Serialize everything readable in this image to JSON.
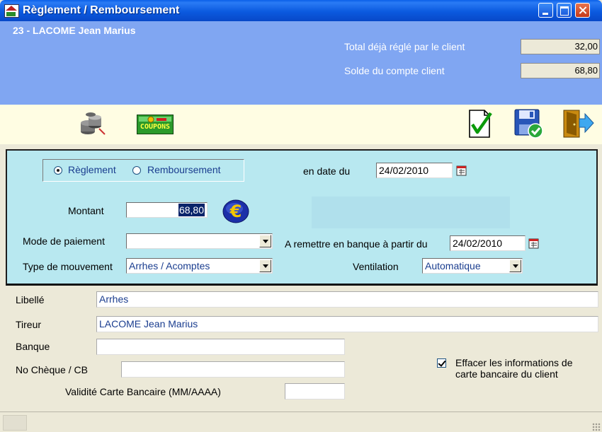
{
  "window": {
    "title": "Règlement / Remboursement"
  },
  "header": {
    "client_name": "23 - LACOME Jean Marius",
    "total_label": "Total déjà réglé par le client",
    "total_value": "32,00",
    "solde_label": "Solde du compte client",
    "solde_value": "68,80"
  },
  "toolbar": {
    "coupons_label": "COUPONS",
    "icons": [
      "coins-icon",
      "coupons-icon",
      "validate-check-icon",
      "save-icon",
      "exit-door-icon"
    ]
  },
  "panel": {
    "radio_reglement": "Règlement",
    "radio_remboursement": "Remboursement",
    "selected": "Règlement",
    "date_label": "en date du",
    "date_value": "24/02/2010",
    "montant_label": "Montant",
    "montant_value": "68,80",
    "mode_label": "Mode de paiement",
    "mode_value": "",
    "remise_label": "A remettre en banque à partir du",
    "remise_date": "24/02/2010",
    "type_label": "Type de mouvement",
    "type_value": "Arrhes / Acomptes",
    "ventilation_label": "Ventilation",
    "ventilation_value": "Automatique"
  },
  "form": {
    "libelle_label": "Libellé",
    "libelle_value": "Arrhes",
    "tireur_label": "Tireur",
    "tireur_value": "LACOME Jean Marius",
    "banque_label": "Banque",
    "banque_value": "",
    "cheque_label": "No Chèque / CB",
    "cheque_value": "",
    "validite_label": "Validité Carte Bancaire (MM/AAAA)",
    "validite_value": "",
    "effacer_label": "Effacer les informations de carte bancaire du client",
    "effacer_checked": true
  },
  "colors": {
    "titlebar": "#0A5FE8",
    "header": "#80A6F2",
    "toolbar": "#FFFDE3",
    "panel": "#B8E8F0",
    "text_blue": "#1a3d8f"
  }
}
